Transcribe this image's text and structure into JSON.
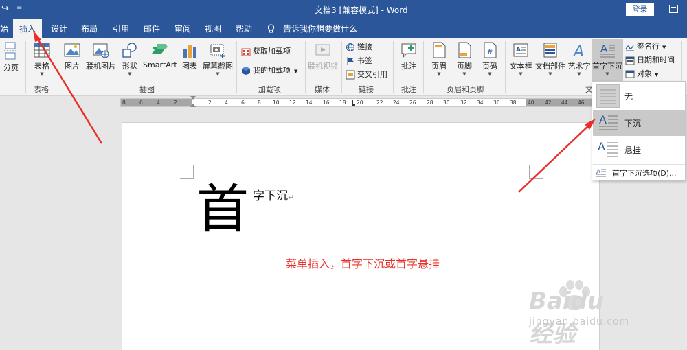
{
  "titlebar": {
    "title": "文档3 [兼容模式] - Word",
    "login_label": "登录",
    "quick_access_undo": "↪",
    "quick_access_more": "="
  },
  "tabs": {
    "file_partial": "始",
    "items": [
      "插入",
      "设计",
      "布局",
      "引用",
      "邮件",
      "审阅",
      "视图",
      "帮助"
    ],
    "tell_me": "告诉我你想要做什么"
  },
  "ribbon": {
    "pages": {
      "page_break": "分页"
    },
    "tables": {
      "table": "表格",
      "group": "表格"
    },
    "illustrations": {
      "pictures": "图片",
      "online_pictures": "联机图片",
      "shapes": "形状",
      "smartart": "SmartArt",
      "chart": "图表",
      "screenshot": "屏幕截图",
      "group": "插图"
    },
    "addins": {
      "get_addins": "获取加载项",
      "my_addins": "我的加载项",
      "group": "加载项"
    },
    "media": {
      "online_video": "联机视频",
      "group": "媒体"
    },
    "links": {
      "link": "链接",
      "bookmark": "书签",
      "cross_reference": "交叉引用",
      "group": "链接"
    },
    "comments": {
      "comment": "批注",
      "group": "批注"
    },
    "header_footer": {
      "header": "页眉",
      "footer": "页脚",
      "page_number": "页码",
      "group": "页眉和页脚"
    },
    "text": {
      "text_box": "文本框",
      "quick_parts": "文档部件",
      "wordart": "艺术字",
      "drop_cap": "首字下沉",
      "signature_line": "签名行",
      "date_time": "日期和时间",
      "object": "对象",
      "group_partial": "文"
    }
  },
  "ruler": {
    "left_numbers": [
      "8",
      "6",
      "4",
      "2"
    ],
    "right_numbers": [
      "2",
      "4",
      "6",
      "8",
      "10",
      "12",
      "14",
      "16",
      "18",
      "20",
      "22",
      "24",
      "26",
      "28",
      "30",
      "32",
      "34",
      "36",
      "38",
      "40",
      "42",
      "44",
      "46"
    ]
  },
  "document": {
    "drop_cap_char": "首",
    "rest_text": "字下沉",
    "paragraph_mark": "↵",
    "annotation": "菜单插入，首字下沉或首字悬挂"
  },
  "dropcap_menu": {
    "none": "无",
    "dropped": "下沉",
    "in_margin": "悬挂",
    "options": "首字下沉选项(D)..."
  },
  "watermark": {
    "brand": "Baidu经验",
    "url": "jingyan.baidu.com"
  },
  "colors": {
    "accent": "#2b579a",
    "annotation_red": "#e8302a",
    "highlight": "#c9c9c9"
  }
}
